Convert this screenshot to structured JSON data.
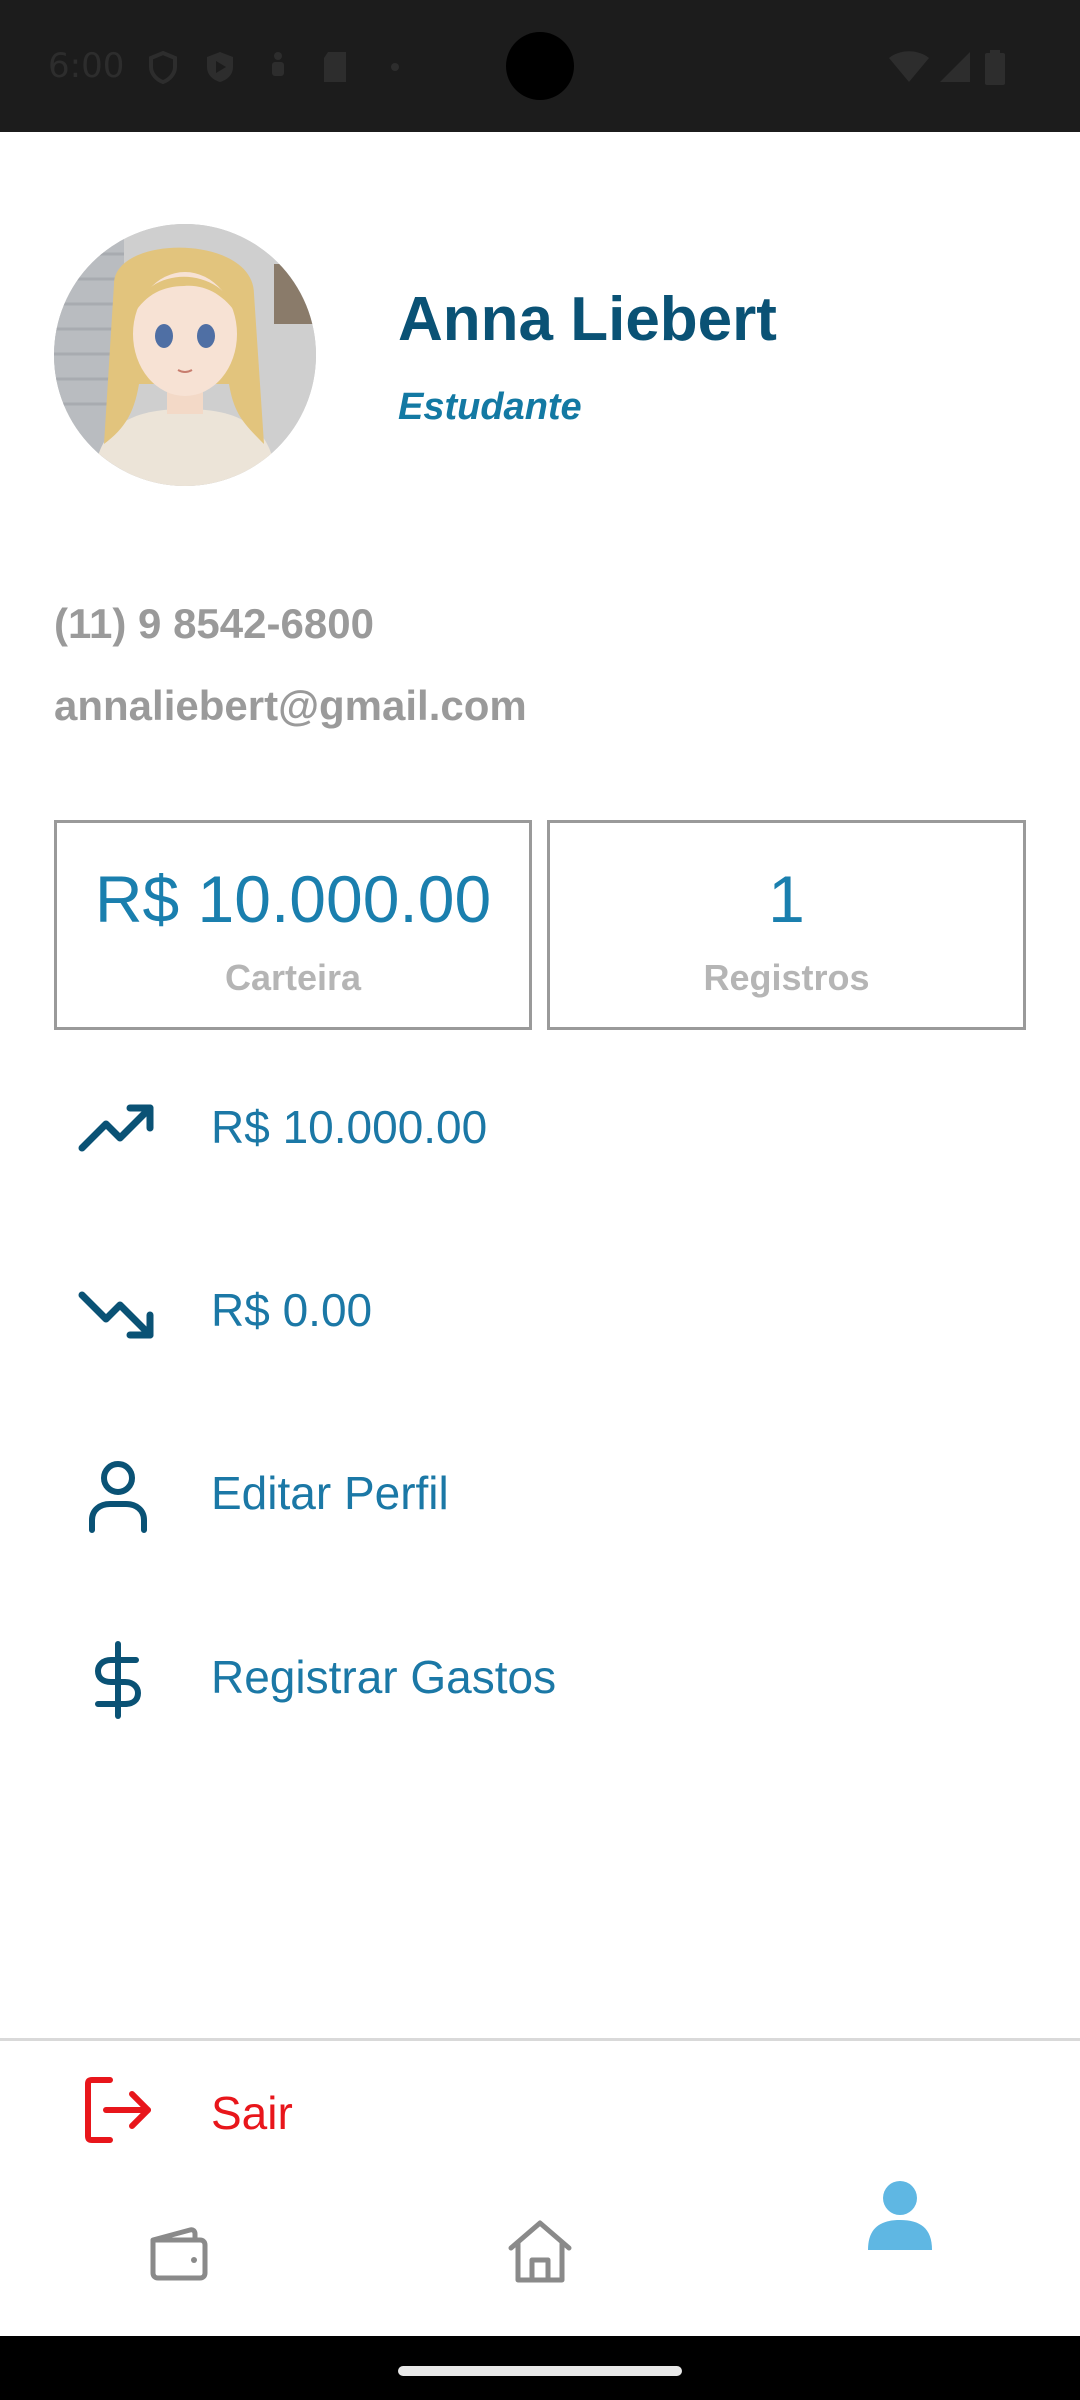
{
  "status_bar": {
    "time": "6:00"
  },
  "profile": {
    "name": "Anna Liebert",
    "role": "Estudante",
    "phone": "(11) 9 8542-6800",
    "email": "annaliebert@gmail.com",
    "avatar_icon": "anime-portrait-avatar"
  },
  "stats": [
    {
      "value": "R$ 10.000.00",
      "label": "Carteira"
    },
    {
      "value": "1",
      "label": "Registros"
    }
  ],
  "menu": [
    {
      "icon": "trending-up-icon",
      "label": "R$ 10.000.00"
    },
    {
      "icon": "trending-down-icon",
      "label": "R$ 0.00"
    },
    {
      "icon": "user-icon",
      "label": "Editar Perfil"
    },
    {
      "icon": "dollar-icon",
      "label": "Registrar Gastos"
    }
  ],
  "logout": {
    "icon": "logout-icon",
    "label": "Sair"
  },
  "bottom_nav": [
    {
      "icon": "wallet-icon",
      "active": false
    },
    {
      "icon": "home-icon",
      "active": false
    },
    {
      "icon": "profile-icon",
      "active": true
    }
  ],
  "colors": {
    "primary_dark": "#0a5275",
    "primary": "#1a7fae",
    "muted": "#9a9a9a",
    "danger": "#e8161b",
    "nav_active": "#5fb7e3",
    "nav_inactive": "#8a8a8a"
  }
}
